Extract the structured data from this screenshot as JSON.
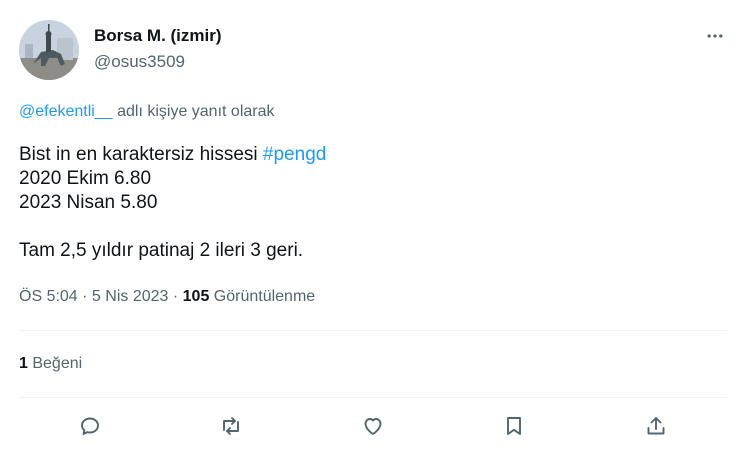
{
  "author": {
    "name": "Borsa M. (izmir)",
    "handle": "@osus3509"
  },
  "reply": {
    "mention": "@efekentli__",
    "suffix": " adlı kişiye yanıt olarak"
  },
  "tweet": {
    "line1_text": "Bist in en karaktersiz hissesi ",
    "line1_hashtag": "#pengd",
    "line2": "2020 Ekim 6.80",
    "line3": "2023 Nisan 5.80",
    "line4": "Tam 2,5 yıldır patinaj 2 ileri 3 geri."
  },
  "meta": {
    "time": "ÖS 5:04",
    "sep1": " · ",
    "date": "5 Nis 2023",
    "sep2": " · ",
    "views_count": "105",
    "views_label": " Görüntülenme"
  },
  "likes": {
    "count": "1",
    "label": " Beğeni"
  },
  "icons": {
    "more": "more-horizontal-icon",
    "reply": "reply-icon",
    "retweet": "retweet-icon",
    "like": "heart-icon",
    "bookmark": "bookmark-icon",
    "share": "share-icon"
  },
  "colors": {
    "link": "#1d9bf0",
    "secondary_text": "#536471",
    "primary_text": "#0f1419",
    "divider": "#eff3f4"
  }
}
